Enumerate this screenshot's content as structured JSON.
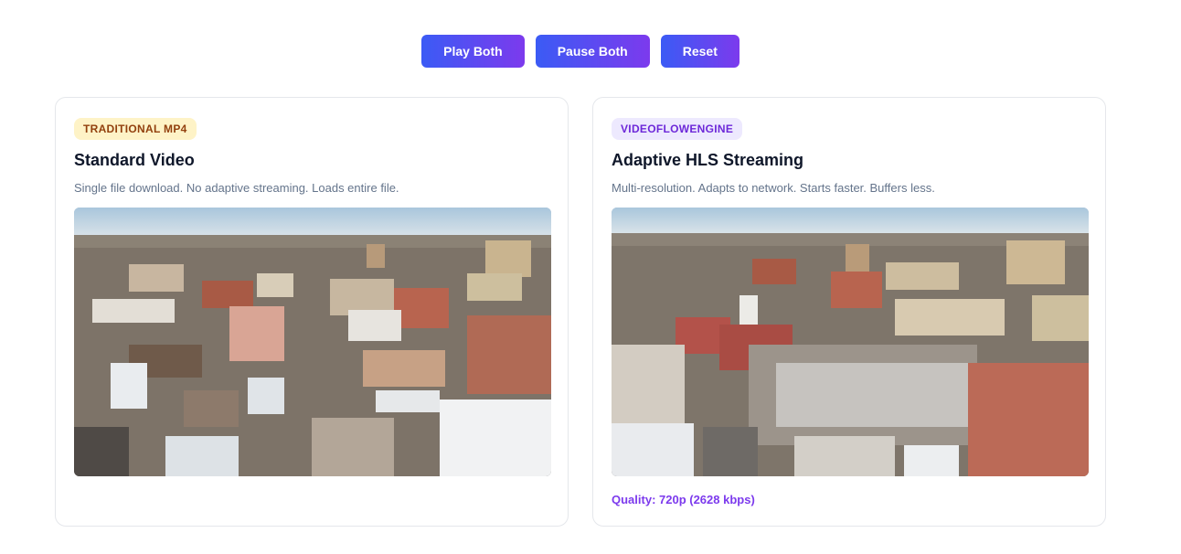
{
  "controls": {
    "play_label": "Play Both",
    "pause_label": "Pause Both",
    "reset_label": "Reset"
  },
  "standard": {
    "badge": "TRADITIONAL MP4",
    "title": "Standard Video",
    "description": "Single file download. No adaptive streaming. Loads entire file."
  },
  "adaptive": {
    "badge": "VIDEOFLOWENGINE",
    "title": "Adaptive HLS Streaming",
    "description": "Multi-resolution. Adapts to network. Starts faster. Buffers less.",
    "quality": "Quality: 720p (2628 kbps)"
  },
  "colors": {
    "accent_start": "#3b5bf5",
    "accent_end": "#7c3aed",
    "mp4_badge_bg": "#fef3c7",
    "mp4_badge_text": "#92400e",
    "vfe_badge_bg": "#ede9fe",
    "vfe_badge_text": "#6d28d9"
  }
}
